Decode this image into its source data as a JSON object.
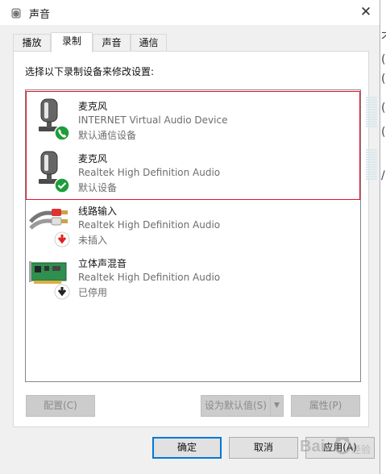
{
  "window": {
    "title": "声音",
    "close_glyph": "✕"
  },
  "tabs": [
    {
      "label": "播放",
      "active": false
    },
    {
      "label": "录制",
      "active": true
    },
    {
      "label": "声音",
      "active": false
    },
    {
      "label": "通信",
      "active": false
    }
  ],
  "instruction": "选择以下录制设备来修改设置:",
  "devices": [
    {
      "name": "麦克风",
      "description": "INTERNET Virtual Audio Device",
      "status": "默认通信设备",
      "icon": "microphone-icon",
      "badge": "phone-icon",
      "badge_color": "#1e9e3a",
      "selected": true
    },
    {
      "name": "麦克风",
      "description": "Realtek High Definition Audio",
      "status": "默认设备",
      "icon": "microphone-icon",
      "badge": "checkmark-icon",
      "badge_color": "#1e9e3a",
      "selected": true
    },
    {
      "name": "线路输入",
      "description": "Realtek High Definition Audio",
      "status": "未插入",
      "icon": "line-in-cable-icon",
      "badge": "red-down-arrow-icon",
      "badge_color": "#e02020",
      "selected": false
    },
    {
      "name": "立体声混音",
      "description": "Realtek High Definition Audio",
      "status": "已停用",
      "icon": "sound-card-icon",
      "badge": "black-down-arrow-icon",
      "badge_color": "#222222",
      "selected": false
    }
  ],
  "buttons": {
    "configure": "配置(C)",
    "set_default": "设为默认值(S)",
    "properties": "属性(P)",
    "ok": "确定",
    "cancel": "取消",
    "apply": "应用(A)"
  },
  "background_right_chars": [
    "不",
    "(",
    "(",
    "(",
    "(",
    "/"
  ],
  "colors": {
    "selection_border": "#e81123",
    "accent": "#0078d7",
    "badge_green": "#1e9e3a"
  }
}
